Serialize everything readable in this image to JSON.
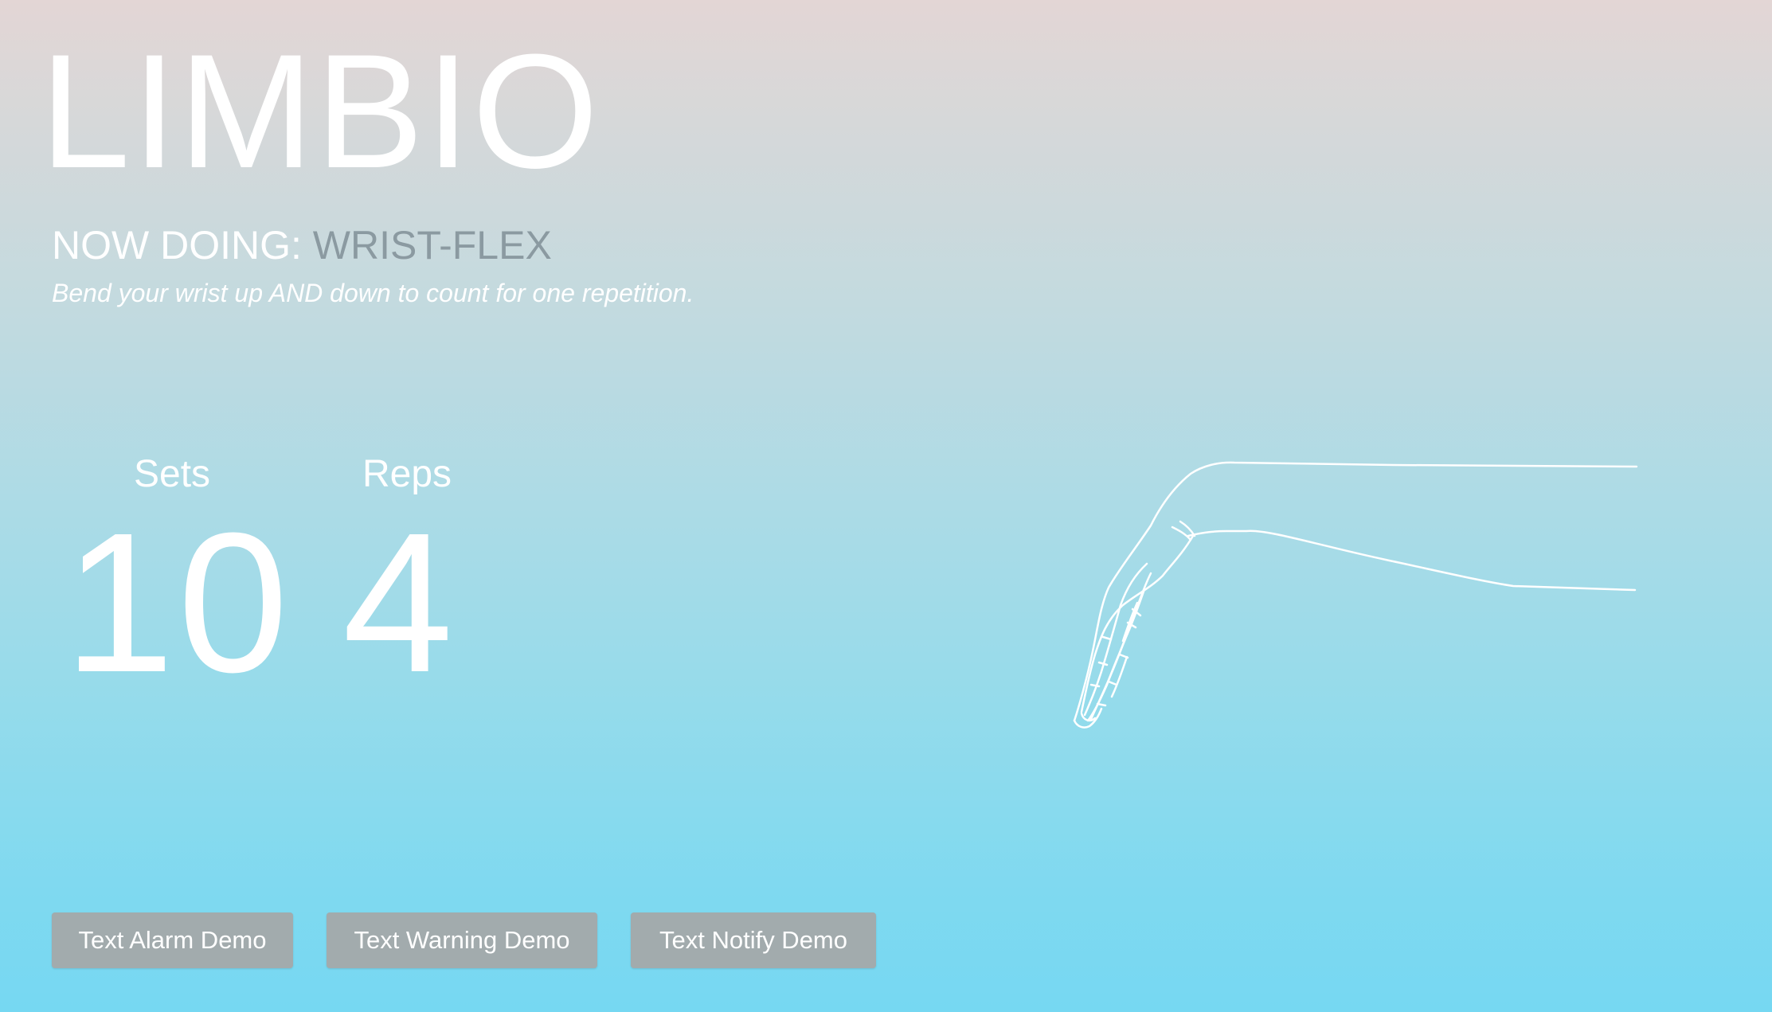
{
  "app": {
    "title": "LIMBIO"
  },
  "exercise": {
    "prefix": "NOW DOING:",
    "name": "WRIST-FLEX",
    "instruction": "Bend your wrist up AND down to count for one repetition."
  },
  "counters": {
    "sets_label": "Sets",
    "sets_value": "10",
    "reps_label": "Reps",
    "reps_value": "4"
  },
  "illustration": {
    "icon": "wrist-flex-hand-icon"
  },
  "buttons": {
    "alarm_label": "Text Alarm Demo",
    "warning_label": "Text Warning Demo",
    "notify_label": "Text Notify Demo"
  },
  "colors": {
    "exercise_name": "#8b9aa1",
    "button_bg": "#a2abad",
    "gradient_top": "#e3d6d5",
    "gradient_bottom": "#76d8f2"
  }
}
